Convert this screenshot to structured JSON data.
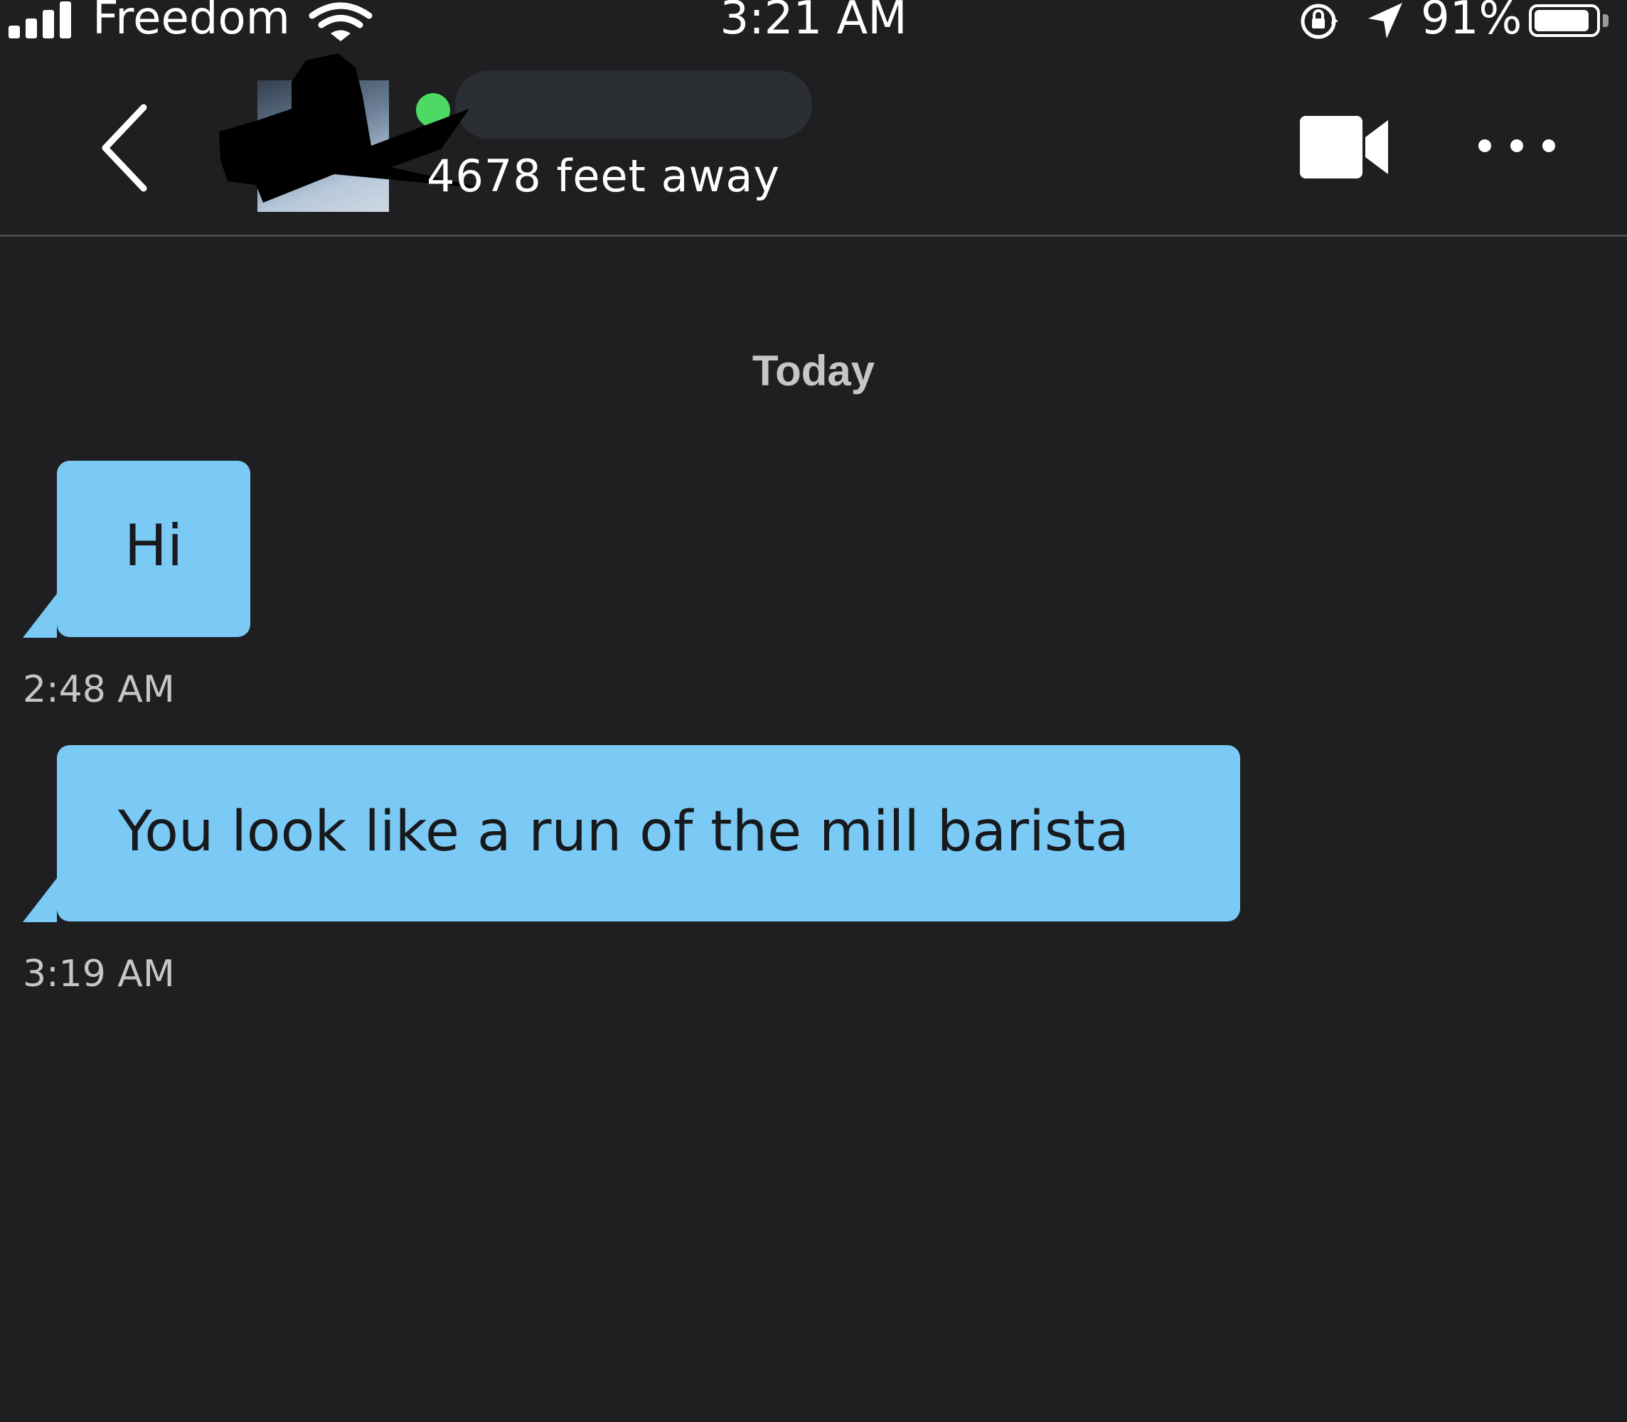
{
  "status_bar": {
    "carrier": "Freedom",
    "time": "3:21 AM",
    "battery_percent": "91%",
    "battery_level": 0.91,
    "signal_bars": 4
  },
  "header": {
    "distance": "4678 feet away",
    "online_color": "#4cd964"
  },
  "conversation": {
    "day_label": "Today",
    "messages": [
      {
        "text": "Hi",
        "timestamp": "2:48 AM"
      },
      {
        "text": "You look like a run of the mill barista",
        "timestamp": "3:19 AM"
      }
    ]
  },
  "colors": {
    "background": "#1f1f21",
    "bubble": "#7bc9f5",
    "bubble_text": "#17191c",
    "secondary_text": "#c6c6c8"
  },
  "icons": [
    "signal-icon",
    "wifi-icon",
    "rotation-lock-icon",
    "location-arrow-icon",
    "battery-icon",
    "back-chevron-icon",
    "video-camera-icon",
    "more-dots-icon"
  ]
}
